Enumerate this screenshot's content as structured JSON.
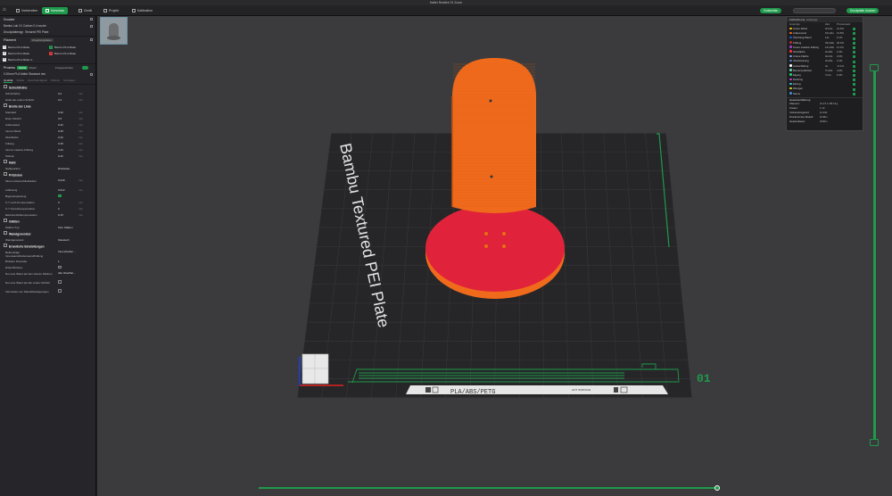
{
  "window": {
    "title": "Halter Realtek S1 Zoom"
  },
  "nav": {
    "tabs": [
      "Vorbereiten",
      "Vorschau",
      "Gerät",
      "Projekt",
      "Kalibration"
    ],
    "active_tab": "Vorschau",
    "slice_button": "Vorbereiten",
    "export_button": "Druckplatte drucken"
  },
  "sidebar": {
    "printer_header": "Drucker",
    "printer_name": "Bambu Lab X1 Carbon 0.4 nozzle",
    "plate_label": "Druckplattentyp",
    "plate_value": "Textured PEI Plate",
    "filament_header": "Filament",
    "filament_badge": "Umgebungsdaten",
    "filaments": [
      {
        "num": "1",
        "name": "Bambu PLA Matte",
        "color": "#e8e8e8"
      },
      {
        "num": "2",
        "name": "Bambu PLA Matte",
        "color": "#1f9a4c"
      },
      {
        "num": "3",
        "name": "Bambu PLA Matte",
        "color": "#e8e8e8"
      },
      {
        "num": "4",
        "name": "Bambu PLA Matte",
        "color": "#e0393c"
      },
      {
        "num": "5",
        "name": "Bambu PLA Matte A...",
        "color": "#e8e8e8"
      }
    ],
    "process_header": "Prozess",
    "process_global": "Global",
    "process_objects": "Objekt",
    "process_advanced": "Fortgeschritten",
    "process_profile": "0.20mm PLA Matte Standard neu",
    "process_tabs": [
      "Qualität",
      "Stärke",
      "Geschwindigkeit",
      "Stützen",
      "Sonstiges"
    ],
    "groups": {
      "layer": "Schichthöhe",
      "line": "Breite der Linie",
      "seam": "Naht",
      "precision": "Präzision",
      "ironing": "Glätten",
      "wall_gen": "Wandgenerator",
      "advanced": "Erweiterte Einstellungen"
    },
    "rows_layer": [
      {
        "label": "Schichthöhe",
        "value": "0.2",
        "unit": "mm"
      },
      {
        "label": "Höhe der ersten Schicht",
        "value": "0.2",
        "unit": "mm"
      }
    ],
    "rows_line": [
      {
        "label": "Standard",
        "value": "0.42",
        "unit": "mm"
      },
      {
        "label": "Erste Schicht",
        "value": "0.5",
        "unit": "mm"
      },
      {
        "label": "Außenwand",
        "value": "0.42",
        "unit": "mm"
      },
      {
        "label": "Innere Wand",
        "value": "0.45",
        "unit": "mm"
      },
      {
        "label": "Oberfläche",
        "value": "0.42",
        "unit": "mm"
      },
      {
        "label": "Füllung",
        "value": "0.45",
        "unit": "mm"
      },
      {
        "label": "Innere massive Füllung",
        "value": "0.42",
        "unit": "mm"
      },
      {
        "label": "Stützen",
        "value": "0.42",
        "unit": "mm"
      }
    ],
    "rows_seam": [
      {
        "label": "Nahtposition",
        "value": "Rückseite"
      }
    ],
    "rows_precision": [
      {
        "label": "Slice-Lückenschließradius",
        "value": "0.049",
        "unit": "mm"
      },
      {
        "label": "Auflösung",
        "value": "0.012",
        "unit": "mm"
      },
      {
        "label": "Bogenanpassung",
        "value": ""
      },
      {
        "label": "X-Y Loch-Kompensation",
        "value": "0",
        "unit": "mm"
      },
      {
        "label": "X-Y Konturkompensation",
        "value": "0",
        "unit": "mm"
      },
      {
        "label": "Elefantenfußkompensation",
        "value": "0.15",
        "unit": "mm"
      }
    ],
    "rows_ironing": [
      {
        "label": "Glätten-Typ",
        "value": "Kein Glätten"
      }
    ],
    "rows_wall": [
      {
        "label": "Wandgenerator",
        "value": "Klassisch"
      }
    ],
    "rows_advanced": [
      {
        "label": "Reihenfolge Innenwand/Außenwand/Füllung",
        "value": "Innen/Außen..."
      },
      {
        "label": "Brücken Flussrate",
        "value": "1"
      },
      {
        "label": "Dicke Brücken",
        "value": ""
      },
      {
        "label": "Nur eine Wand auf den oberen Flächen",
        "value": "Alle Oberfläc..."
      },
      {
        "label": "Nur eine Wand auf der ersten Schicht",
        "value": ""
      },
      {
        "label": "Vermeiden von Wandüberlappungen",
        "value": ""
      }
    ]
  },
  "stats": {
    "header": "Farbschema",
    "header_value": "Linientyp",
    "col_type": "Linientyp",
    "col_time": "Zeit",
    "col_percent": "Prozentsatz",
    "show_label": "Anzeigen",
    "rows": [
      {
        "name": "Innere Wand",
        "time": "3m41s",
        "pct": "21.6%",
        "color": "#f5b800"
      },
      {
        "name": "Außenwand",
        "time": "15m11s",
        "pct": "13.8%",
        "color": "#f56e18"
      },
      {
        "name": "Überhang-Wand",
        "time": "11s",
        "pct": "0.1%",
        "color": "#1f5cd6"
      },
      {
        "name": "Füllung",
        "time": "33m10s",
        "pct": "30.2%",
        "color": "#b02b2b"
      },
      {
        "name": "Innere massive Füllung",
        "time": "12m10s",
        "pct": "11.1%",
        "color": "#a23fc6"
      },
      {
        "name": "Oberfläche",
        "time": "2m29s",
        "pct": "2.3%",
        "color": "#ff3333"
      },
      {
        "name": "Untere Fläche",
        "time": "3m13s",
        "pct": "2.9%",
        "color": "#7b9ce6"
      },
      {
        "name": "Überbrückung",
        "time": "4m34s",
        "pct": "4.1%",
        "color": "#4d78cc"
      },
      {
        "name": "Lückenfüllung",
        "time": "4s",
        "pct": "<0.1%",
        "color": "#ffffff"
      },
      {
        "name": "Benutzerdefiniert",
        "time": "7m43s",
        "pct": "4.6%",
        "color": "#5ad2a6"
      },
      {
        "name": "Eigung",
        "time": "7m1s",
        "pct": "6.3%",
        "color": "#1fcf78"
      },
      {
        "name": "Rückzug",
        "time": "",
        "pct": "",
        "color": "#c23fd2"
      },
      {
        "name": "Einzug",
        "time": "",
        "pct": "",
        "color": "#2bc4d6"
      },
      {
        "name": "Wenigen",
        "time": "",
        "pct": "",
        "color": "#d6d629"
      },
      {
        "name": "Sterne",
        "time": "",
        "pct": "",
        "color": "#3a8bd4"
      }
    ],
    "summary_header": "Gesamtschätzung",
    "summary": [
      {
        "k": "Filament:",
        "v": "21.47 m    68.13 g"
      },
      {
        "k": "Kosten:",
        "v": "1.13"
      },
      {
        "k": "Vorbereitungszeit:",
        "v": "1m34s"
      },
      {
        "k": "Druckzeit des Modell:",
        "v": "1h45m"
      },
      {
        "k": "Gesamtdauer:",
        "v": "1h50m"
      }
    ]
  },
  "plate": {
    "label": "Bambu Textured PEI Plate",
    "material_tag": "PLA/ABS/PETG",
    "hot_surface": "HOT SURFACE",
    "plate_number": "01"
  },
  "colors": {
    "accent": "#1f9a4c",
    "model_orange": "#f06a1c",
    "model_red": "#e0233a"
  }
}
